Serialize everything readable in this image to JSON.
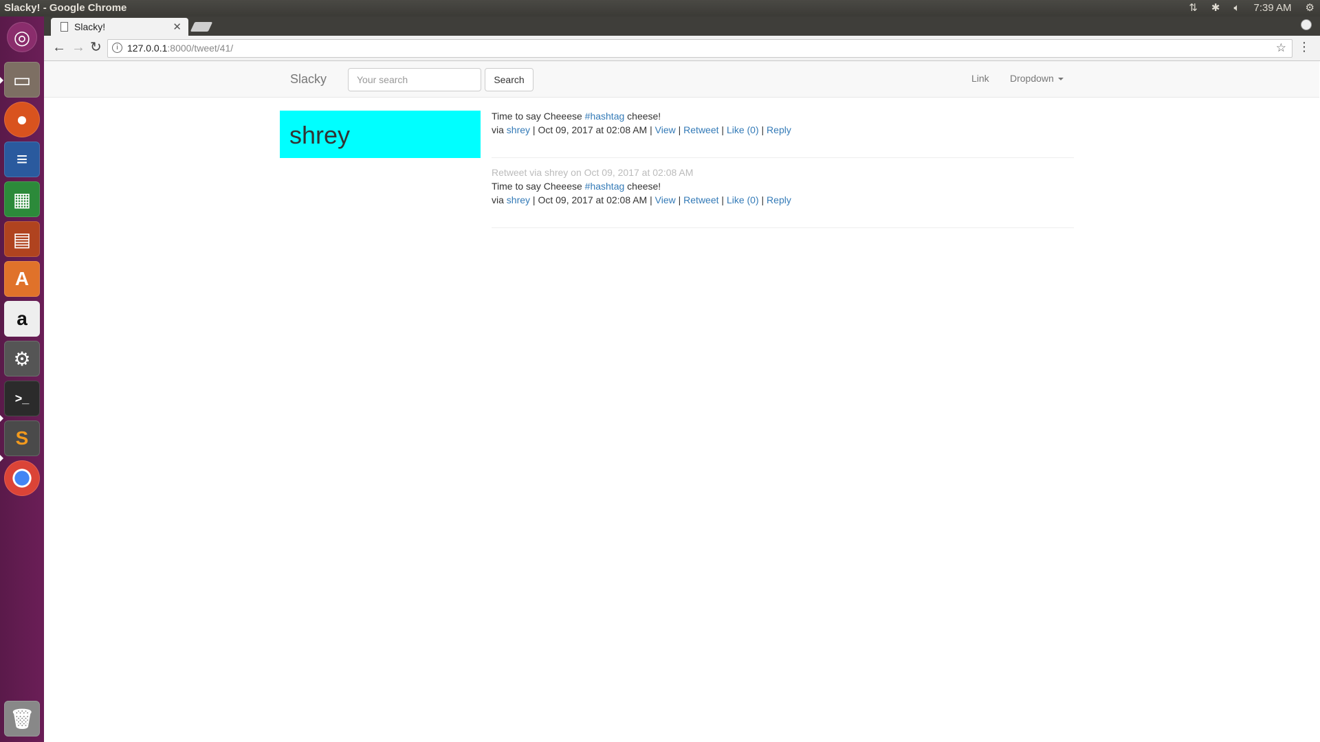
{
  "window": {
    "title": "Slacky! - Google Chrome",
    "clock": "7:39 AM"
  },
  "launcher": {
    "items": [
      "ubuntu-dash-icon",
      "files-icon",
      "firefox-icon",
      "writer-icon",
      "calc-icon",
      "impress-icon",
      "software-center-icon",
      "amazon-icon",
      "system-settings-icon",
      "terminal-icon",
      "sublime-text-icon",
      "chrome-icon",
      "trash-icon"
    ]
  },
  "browser": {
    "tab_title": "Slacky!",
    "url_host": "127.0.0.1",
    "url_rest": ":8000/tweet/41/"
  },
  "navbar": {
    "brand": "Slacky",
    "search_placeholder": "Your search",
    "search_button": "Search",
    "link": "Link",
    "dropdown": "Dropdown"
  },
  "profile": {
    "username": "shrey",
    "bg_color": "#00ffff"
  },
  "tweets": [
    {
      "retweet_header": "",
      "text_before": "Time to say Cheeese ",
      "hashtag": "#hashtag",
      "text_after": " cheese!",
      "via": "via ",
      "author": "shrey",
      "date": " | Oct 09, 2017 at 02:08 AM | ",
      "view": "View",
      "retweet": "Retweet",
      "like": "Like (0)",
      "reply": "Reply"
    },
    {
      "retweet_header": "Retweet via shrey on Oct 09, 2017 at 02:08 AM",
      "text_before": "Time to say Cheeese ",
      "hashtag": "#hashtag",
      "text_after": " cheese!",
      "via": "via ",
      "author": "shrey",
      "date": " | Oct 09, 2017 at 02:08 AM | ",
      "view": "View",
      "retweet": "Retweet",
      "like": "Like (0)",
      "reply": "Reply"
    }
  ],
  "separator": " | ",
  "colors": {
    "link": "#337ab7",
    "launcher": "#6b1e57"
  }
}
